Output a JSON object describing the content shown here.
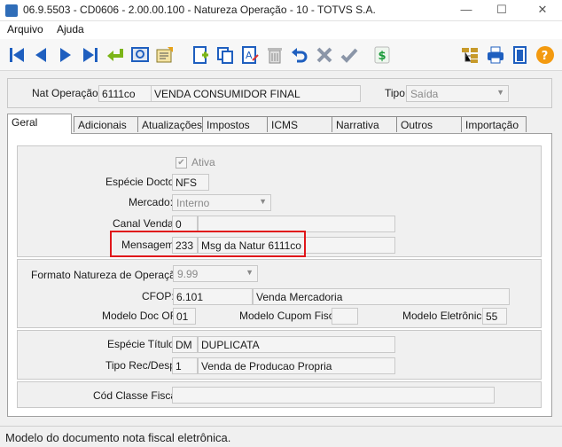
{
  "window": {
    "title": "06.9.5503 - CD0606 - 2.00.00.100 - Natureza Operação - 10 - TOTVS S.A.",
    "minimize": "—",
    "maximize": "☐",
    "close": "✕"
  },
  "menu": {
    "arquivo": "Arquivo",
    "ajuda": "Ajuda"
  },
  "header": {
    "nat_operacao_label": "Nat Operação:",
    "nat_operacao_code": "6111co",
    "nat_operacao_desc": "VENDA CONSUMIDOR FINAL",
    "tipo_label": "Tipo:",
    "tipo_value": "Saída"
  },
  "tabs": [
    "Geral",
    "Adicionais",
    "Atualizações",
    "Impostos",
    "ICMS",
    "Narrativa",
    "Outros",
    "Importação"
  ],
  "geral": {
    "ativa_label": "Ativa",
    "ativa_checked": true,
    "especie_docto_label": "Espécie Docto:",
    "especie_docto_value": "NFS",
    "mercado_label": "Mercado:",
    "mercado_value": "Interno",
    "canal_venda_label": "Canal Venda:",
    "canal_venda_code": "0",
    "canal_venda_desc": "",
    "mensagem_label": "Mensagem:",
    "mensagem_code": "233",
    "mensagem_desc": "Msg da Natur 6111co",
    "formato_label": "Formato Natureza de Operação:",
    "formato_value": "9.99",
    "cfop_label": "CFOP:",
    "cfop_code": "6.101",
    "cfop_desc": "Venda Mercadoria",
    "modelo_doc_of_label": "Modelo Doc OF:",
    "modelo_doc_of_value": "01",
    "modelo_cupom_label": "Modelo Cupom Fiscal:",
    "modelo_cupom_value": "",
    "modelo_eletronico_label": "Modelo Eletrônico:",
    "modelo_eletronico_value": "55",
    "especie_titulo_label": "Espécie Título:",
    "especie_titulo_code": "DM",
    "especie_titulo_desc": "DUPLICATA",
    "tipo_rec_label": "Tipo Rec/Desp:",
    "tipo_rec_code": "1",
    "tipo_rec_desc": "Venda de Producao Propria",
    "cod_classe_label": "Cód Classe Fiscal:",
    "cod_classe_value": ""
  },
  "status": {
    "text": "Modelo do documento nota fiscal eletrônica."
  },
  "colors": {
    "highlight": "#e0161a",
    "toolbar_blue": "#1f5fbf",
    "help_orange": "#f39a10"
  }
}
